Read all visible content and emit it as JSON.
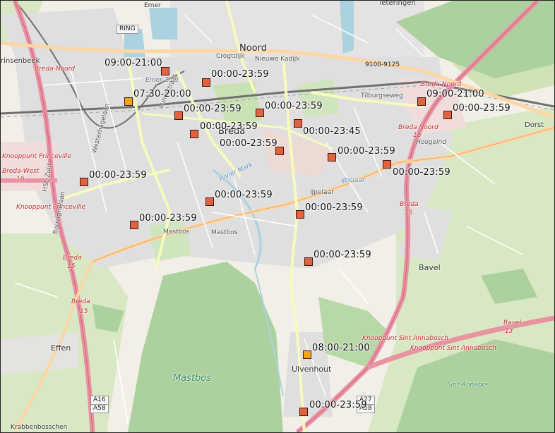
{
  "map": {
    "markers": [
      {
        "hours": "09:00-21:00",
        "kind": "shop"
      },
      {
        "hours": "00:00-23:59",
        "kind": "shop"
      },
      {
        "hours": "07:30-20:00",
        "kind": "fuel"
      },
      {
        "hours": "00:00-23:59",
        "kind": "shop"
      },
      {
        "hours": "00:00-23:59",
        "kind": "shop"
      },
      {
        "hours": "00:00-23:59",
        "kind": "shop"
      },
      {
        "hours": "00:00-23:45",
        "kind": "shop"
      },
      {
        "hours": "00:00-23:59",
        "kind": "shop"
      },
      {
        "hours": "00:00-23:59",
        "kind": "shop"
      },
      {
        "hours": "09:00-21:00",
        "kind": "shop"
      },
      {
        "hours": "00:00-23:59",
        "kind": "shop"
      },
      {
        "hours": "00:00-23:59",
        "kind": "shop"
      },
      {
        "hours": "00:00-23:59",
        "kind": "shop"
      },
      {
        "hours": "00:00-23:59",
        "kind": "shop"
      },
      {
        "hours": "00:00-23:59",
        "kind": "shop"
      },
      {
        "hours": "00:00-23:59",
        "kind": "shop"
      },
      {
        "hours": "00:00-23:59",
        "kind": "shop"
      },
      {
        "hours": "08:00-21:00",
        "kind": "fuel"
      },
      {
        "hours": "00:00-23:59",
        "kind": "shop"
      }
    ],
    "marker_colors": {
      "shop": "#e2623f",
      "fuel": "#f7a21b"
    },
    "place_labels": {
      "emer": "Emer",
      "teteringen": "Teteringen",
      "noord": "Noord",
      "prinsenbeek": "rinsenbeek",
      "breda_noord": "Breda-Noord",
      "emer_zuid": "Emer-Zuid",
      "crogtdijk": "Crogtdijk",
      "nieuwe_kadijk": "Nieuwe Kadijk",
      "tilburgseweg": "Tilburgseweg",
      "breda_noord_right": "Breda-Noord",
      "dorst": "Dorst",
      "lunetstraat": "Lunetstraat",
      "breda": "Breda",
      "westerhagelaan": "Westerhagelaan",
      "knooppunt_princeville": "Knooppunt Princeville",
      "hsl_zuid": "HSL-Zuid",
      "breda_west": "Breda-West",
      "ijpelaar": "IJpelaar",
      "riviermark": "Rivier Mark",
      "knooppunt_princeville_2": "Knooppunt Princeville",
      "bouvignelaan": "Bouvignelaan",
      "mastbos_road": "Mastbos",
      "mastbos_road2": "Mastbos",
      "breda_noord_jn": "Breda Noord",
      "hoogeind": "Hoogeind",
      "breda_15": "Breda",
      "breda_left": "Breda",
      "breda_left2": "Breda",
      "bavel": "Bavel",
      "bavel_jn": "Bavel",
      "knooppunt_sint_annabosch": "Knooppunt Sint Annabosch",
      "knooppunt_sint_annabosch_2": "Knooppunt Sint Annabosch",
      "effen": "Effen",
      "ulvenhout": "Ulvenhout",
      "mastbos_forest": "Mastbos",
      "sint_annabos": "Sint-Annabos",
      "krabbenbosschen": "Krabbenbosschen",
      "ring": "RING",
      "ring_code": "9100-9125",
      "a16": "A16",
      "a58": "A58",
      "a27": "A27",
      "a58b": "A58",
      "jn_16": "16",
      "jn_15": "15",
      "jn_15b": "15",
      "jn_13": "13",
      "jn_16b": "16",
      "jn_15c": "15"
    }
  }
}
